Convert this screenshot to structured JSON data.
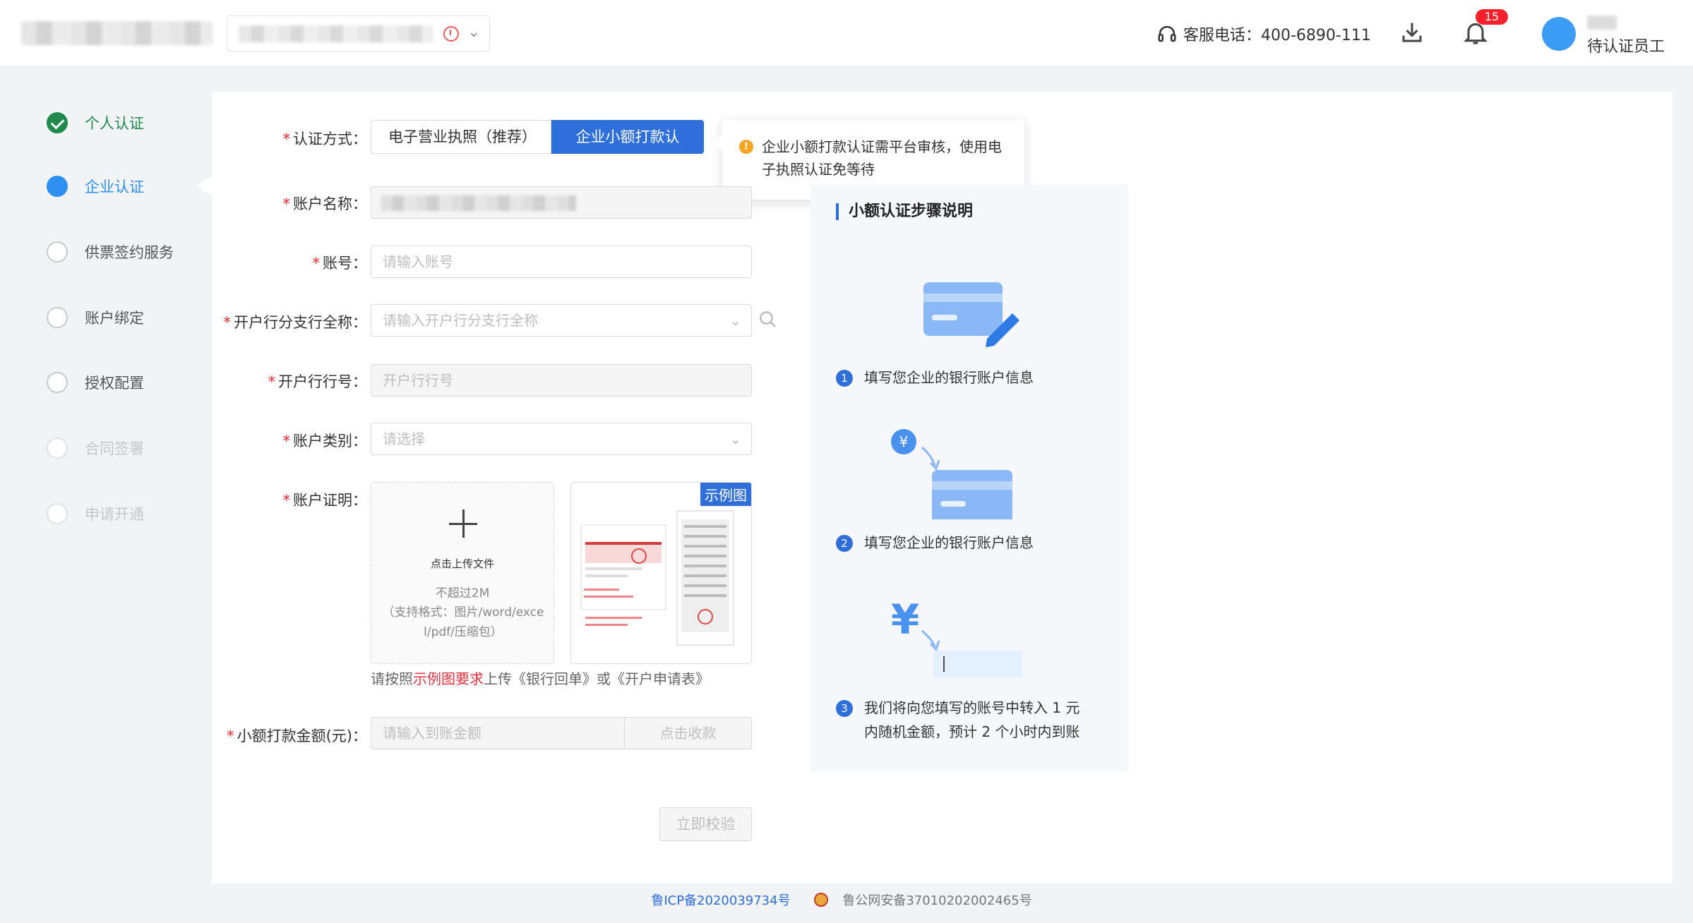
{
  "header": {
    "hotline_label": "客服电话：400-6890-111",
    "notification_count": "15",
    "user_role": "待认证员工"
  },
  "steps": [
    {
      "label": "个人认证",
      "state": "done"
    },
    {
      "label": "企业认证",
      "state": "active"
    },
    {
      "label": "供票签约服务",
      "state": "pending"
    },
    {
      "label": "账户绑定",
      "state": "pending"
    },
    {
      "label": "授权配置",
      "state": "pending"
    },
    {
      "label": "合同签署",
      "state": "disabled"
    },
    {
      "label": "申请开通",
      "state": "disabled"
    }
  ],
  "form": {
    "method_label": "认证方式：",
    "method_options": [
      "电子营业执照（推荐）",
      "企业小额打款认证"
    ],
    "tip": "企业小额打款认证需平台审核，使用电子执照认证免等待",
    "account_name_label": "账户名称：",
    "account_no_label": "账号：",
    "account_no_placeholder": "请输入账号",
    "bank_branch_label": "开户行分支行全称：",
    "bank_branch_placeholder": "请输入开户行分支行全称",
    "bank_code_label": "开户行行号：",
    "bank_code_placeholder": "开户行行号",
    "account_type_label": "账户类别：",
    "account_type_placeholder": "请选择",
    "proof_label": "账户证明：",
    "upload_title": "点击上传文件",
    "upload_limit": "不超过2M",
    "upload_formats": "（支持格式：图片/word/excel/pdf/压缩包）",
    "sample_tag": "示例图",
    "hint_prefix": "请按照",
    "hint_link": "示例图要求",
    "hint_suffix": "上传《银行回单》或《开户申请表》",
    "amount_label": "小额打款金额(元)：",
    "amount_placeholder": "请输入到账金额",
    "collect_button": "点击收款",
    "verify_button": "立即校验"
  },
  "guide": {
    "title": "小额认证步骤说明",
    "steps": [
      {
        "n": "1",
        "text": "填写您企业的银行账户信息"
      },
      {
        "n": "2",
        "text": "填写您企业的银行账户信息"
      },
      {
        "n": "3",
        "text_line1": "我们将向您填写的账号中转入 1 元",
        "text_line2": "内随机金额，预计 2 个小时内到账"
      }
    ]
  },
  "footer": {
    "icp": "鲁ICP备2020039734号",
    "police": "鲁公网安备37010202002465号"
  },
  "colors": {
    "primary": "#2e6fd9",
    "success": "#1e8a4c",
    "active_step": "#2e90f0",
    "required": "#f5222d"
  }
}
